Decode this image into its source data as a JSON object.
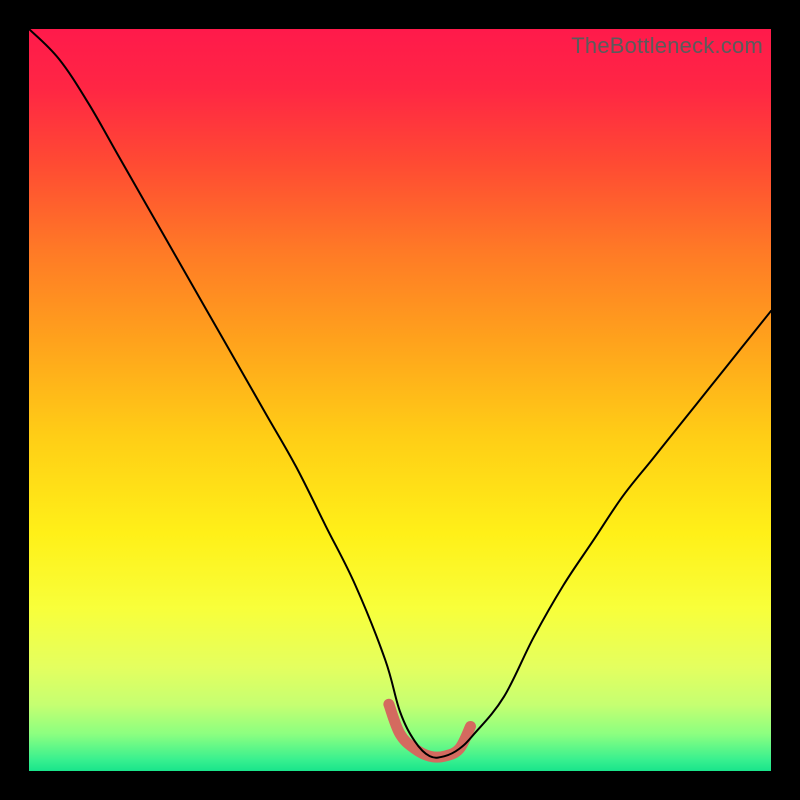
{
  "watermark": {
    "text": "TheBottleneck.com"
  },
  "gradient": {
    "stops": [
      {
        "offset": 0.0,
        "color": "#ff1a4b"
      },
      {
        "offset": 0.08,
        "color": "#ff2644"
      },
      {
        "offset": 0.18,
        "color": "#ff4a33"
      },
      {
        "offset": 0.3,
        "color": "#ff7a26"
      },
      {
        "offset": 0.42,
        "color": "#ffa21c"
      },
      {
        "offset": 0.55,
        "color": "#ffce16"
      },
      {
        "offset": 0.68,
        "color": "#fff018"
      },
      {
        "offset": 0.78,
        "color": "#f8ff3a"
      },
      {
        "offset": 0.86,
        "color": "#e4ff5f"
      },
      {
        "offset": 0.91,
        "color": "#c6ff71"
      },
      {
        "offset": 0.95,
        "color": "#8cff80"
      },
      {
        "offset": 0.985,
        "color": "#38f08f"
      },
      {
        "offset": 1.0,
        "color": "#19e58b"
      }
    ]
  },
  "chart_data": {
    "type": "line",
    "title": "",
    "xlabel": "",
    "ylabel": "",
    "xlim": [
      0,
      100
    ],
    "ylim": [
      0,
      100
    ],
    "series": [
      {
        "name": "black-curve",
        "x": [
          0,
          4,
          8,
          12,
          16,
          20,
          24,
          28,
          32,
          36,
          40,
          44,
          48,
          50,
          52,
          54,
          56,
          58,
          60,
          64,
          68,
          72,
          76,
          80,
          84,
          88,
          92,
          96,
          100
        ],
        "values": [
          100,
          96,
          90,
          83,
          76,
          69,
          62,
          55,
          48,
          41,
          33,
          25,
          15,
          8,
          4,
          2,
          2,
          3,
          5,
          10,
          18,
          25,
          31,
          37,
          42,
          47,
          52,
          57,
          62
        ]
      },
      {
        "name": "red-flat-segment",
        "x": [
          48.5,
          50,
          52,
          54,
          56,
          58,
          59.5
        ],
        "values": [
          9,
          5,
          3,
          2,
          2,
          3,
          6
        ]
      }
    ],
    "annotations": []
  },
  "styles": {
    "black_stroke": "#000000",
    "black_width": 2.0,
    "red_stroke": "#d46a5f",
    "red_width": 11
  }
}
